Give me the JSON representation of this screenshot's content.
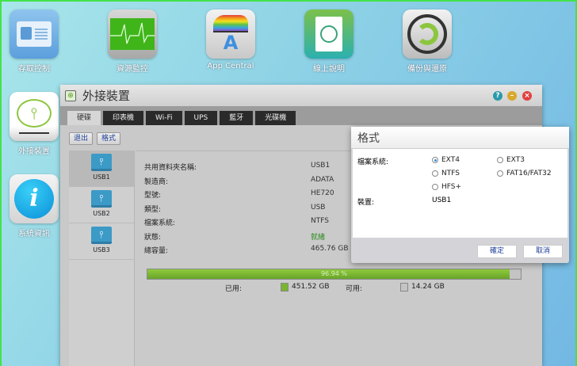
{
  "desktop": {
    "icons": [
      {
        "label": "存取控制",
        "icon": "id-card-icon"
      },
      {
        "label": "資源監控",
        "icon": "heartbeat-monitor-icon"
      },
      {
        "label": "App Central",
        "icon": "app-central-icon"
      },
      {
        "label": "線上說明",
        "icon": "compass-book-icon"
      },
      {
        "label": "備份與還原",
        "icon": "backup-restore-icon"
      },
      {
        "label": "外接裝置",
        "icon": "usb-device-icon"
      },
      {
        "label": "系統資訊",
        "icon": "info-icon"
      }
    ]
  },
  "window": {
    "title": "外接裝置",
    "tabs": [
      "硬碟",
      "印表機",
      "Wi-Fi",
      "UPS",
      "藍牙",
      "光碟機"
    ],
    "toolbar": {
      "eject": "退出",
      "format": "格式"
    },
    "devices": [
      "USB1",
      "USB2",
      "USB3"
    ],
    "details": [
      {
        "label": "共用資料夾名稱:",
        "value": "USB1"
      },
      {
        "label": "製造商:",
        "value": "ADATA"
      },
      {
        "label": "型號:",
        "value": "HE720"
      },
      {
        "label": "類型:",
        "value": "USB"
      },
      {
        "label": "檔案系統:",
        "value": "NTFS"
      },
      {
        "label": "狀態:",
        "value": "就緒"
      },
      {
        "label": "總容量:",
        "value": "465.76 GB"
      }
    ],
    "usage": {
      "percent_text": "96.94 %",
      "percent": 96.94,
      "used_label": "已用:",
      "used": "451.52 GB",
      "free_label": "可用:",
      "free": "14.24 GB",
      "used_color": "#7ab532",
      "status_color": "#2a8a1c"
    }
  },
  "dialog": {
    "title": "格式",
    "fs_label": "檔案系統:",
    "options": [
      "EXT4",
      "EXT3",
      "NTFS",
      "FAT16/FAT32",
      "HFS+"
    ],
    "selected": "EXT4",
    "device_label": "裝置:",
    "device": "USB1",
    "ok": "確定",
    "cancel": "取消"
  }
}
